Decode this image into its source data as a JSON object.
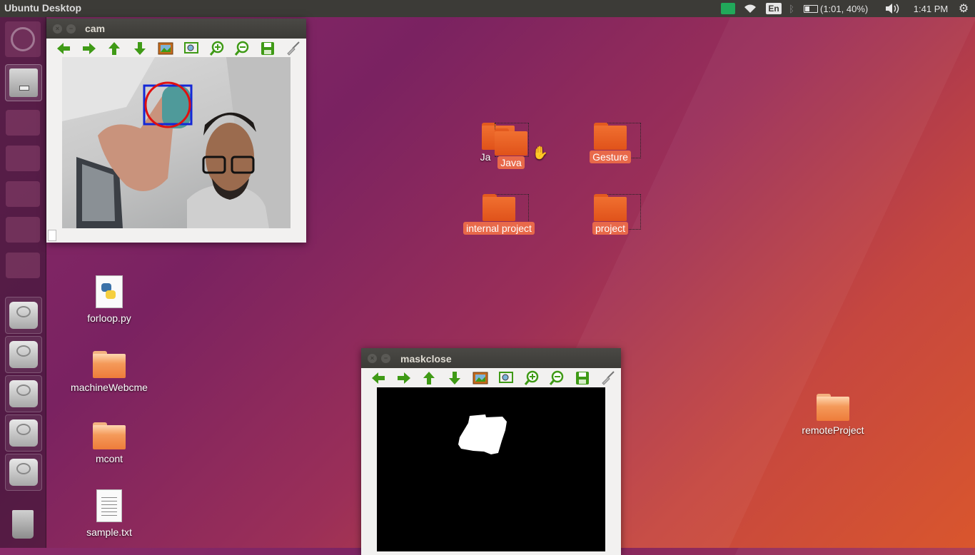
{
  "top_panel": {
    "title": "Ubuntu Desktop",
    "language": "En",
    "battery": "(1:01, 40%)",
    "clock": "1:41 PM",
    "icons": [
      "camera-icon",
      "wifi-icon",
      "bluetooth-icon",
      "battery-icon",
      "volume-icon",
      "settings-gear-icon"
    ]
  },
  "launcher": {
    "items": [
      "dash",
      "files",
      "pycharm",
      "amazon",
      "drive",
      "drive",
      "drive",
      "drive",
      "drive",
      "trash"
    ]
  },
  "windows": {
    "cam": {
      "title": "cam"
    },
    "mask": {
      "title": "maskclose"
    },
    "toolbar_icons": [
      "arrow-left-icon",
      "arrow-right-icon",
      "arrow-up-icon",
      "arrow-down-icon",
      "image-icon",
      "zoom-fit-icon",
      "zoom-in-icon",
      "zoom-out-icon",
      "save-icon",
      "brush-icon"
    ]
  },
  "desktop_icons": {
    "java_behind": "Ja",
    "java": "Java",
    "gesture": "Gesture",
    "internal_project": "internal project",
    "project": "project",
    "forloop": "forloop.py",
    "machine": "machineWebcme",
    "mcont": "mcont",
    "sample": "sample.txt",
    "remote": "remoteProject"
  },
  "colors": {
    "panel": "#3c3b37",
    "selection": "#e8694a",
    "folder": "#e0521a",
    "tool_green": "#3f9a16"
  }
}
